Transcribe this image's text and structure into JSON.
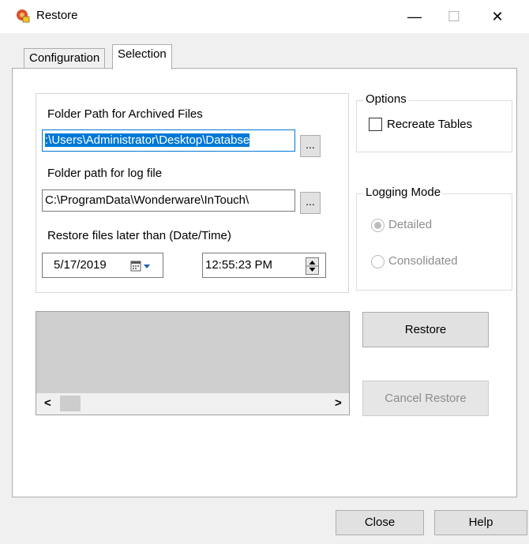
{
  "window": {
    "title": "Restore",
    "controls": {
      "minimize": "—",
      "maximize": "☐",
      "close": "✕"
    }
  },
  "tabs": [
    {
      "label": "Configuration",
      "active": false
    },
    {
      "label": "Selection",
      "active": true
    }
  ],
  "selection": {
    "archive_folder_label": "Folder Path for Archived Files",
    "archive_folder_value": ":\\Users\\Administrator\\Desktop\\Databse",
    "browse_label": "...",
    "log_folder_label": "Folder path for log file",
    "log_folder_value": "C:\\ProgramData\\Wonderware\\InTouch\\",
    "restore_after_label": "Restore files later than (Date/Time)",
    "date_value": "5/17/2019",
    "time_value": "12:55:23 PM"
  },
  "options": {
    "title": "Options",
    "recreate_tables_label": "Recreate Tables",
    "recreate_tables_checked": false
  },
  "logging_mode": {
    "title": "Logging Mode",
    "detailed_label": "Detailed",
    "consolidated_label": "Consolidated",
    "selected": "Detailed",
    "enabled": false
  },
  "buttons": {
    "restore": "Restore",
    "cancel_restore": "Cancel Restore",
    "close": "Close",
    "help": "Help"
  },
  "scroll": {
    "left": "<",
    "right": ">"
  }
}
